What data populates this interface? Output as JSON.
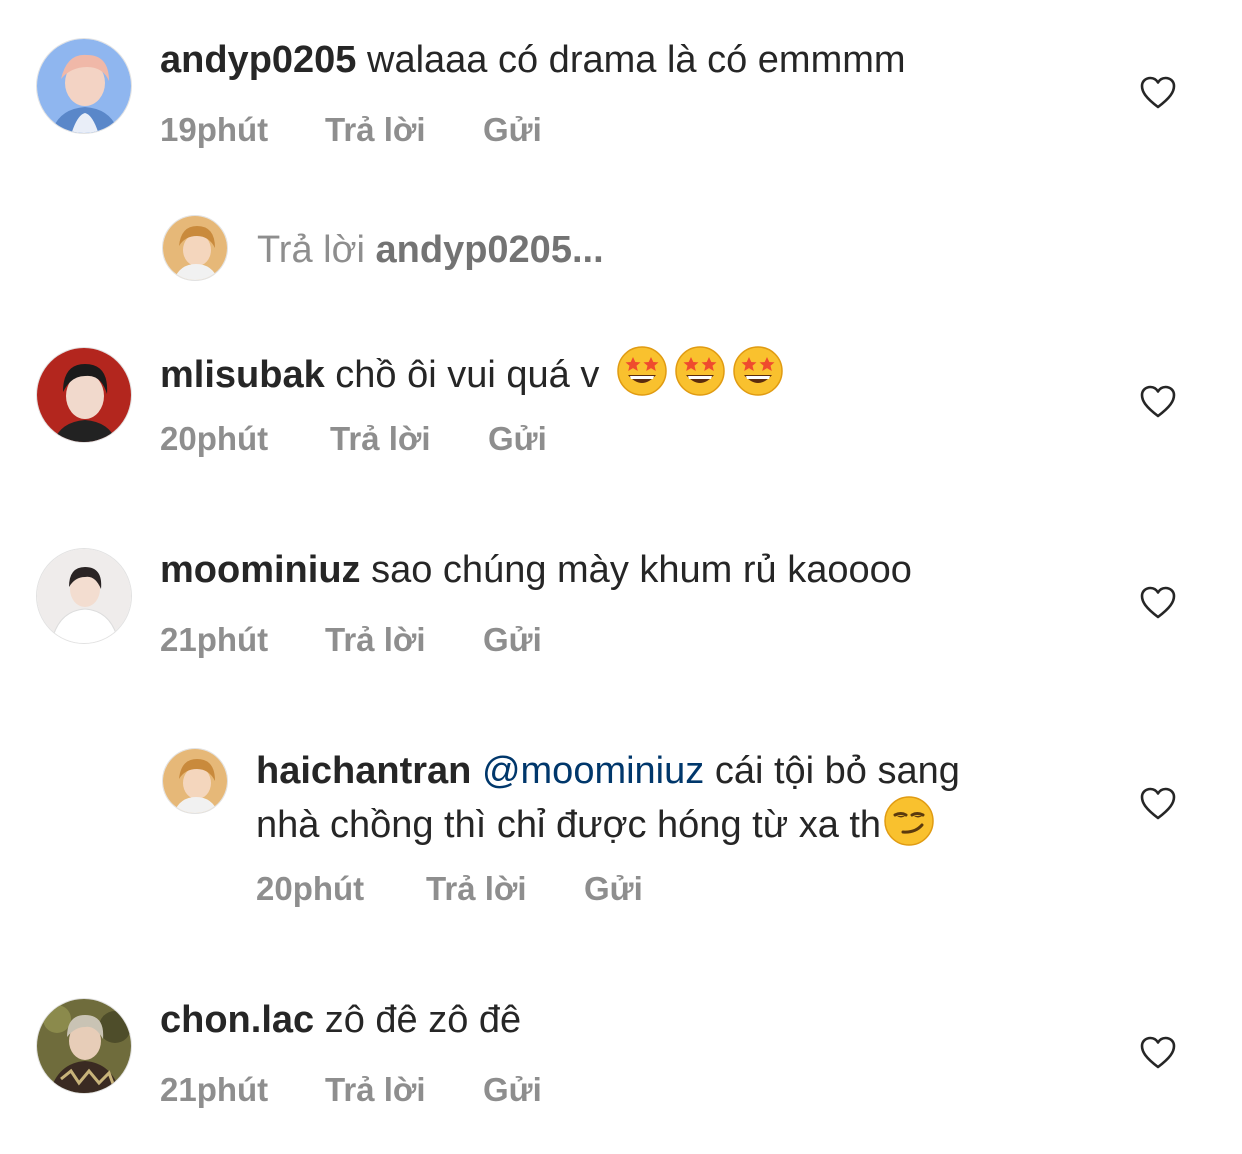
{
  "comments": [
    {
      "username": "andyp0205",
      "text": "walaaa có drama là có emmmm",
      "time": "19phút",
      "reply_label": "Trả lời",
      "send_label": "Gửi",
      "avatar_color": "#7fa9e8",
      "icon": "heart-outline-icon"
    },
    {
      "username": "mlisubak",
      "text": "chồ ôi vui quá v",
      "emoji": [
        "star-struck-emoji",
        "star-struck-emoji",
        "star-struck-emoji"
      ],
      "time": "20phút",
      "reply_label": "Trả lời",
      "send_label": "Gửi",
      "avatar_color": "#b52a22",
      "icon": "heart-outline-icon"
    },
    {
      "username": "moominiuz",
      "text": "sao chúng mày khum rủ kaoooo",
      "time": "21phút",
      "reply_label": "Trả lời",
      "send_label": "Gửi",
      "avatar_color": "#ece9e6",
      "icon": "heart-outline-icon"
    },
    {
      "username": "chon.lac",
      "text": "zô đê zô đê",
      "time": "21phút",
      "reply_label": "Trả lời",
      "send_label": "Gửi",
      "avatar_color": "#5b5a3a",
      "icon": "heart-outline-icon"
    }
  ],
  "reply_prompt": {
    "prefix": "Trả lời",
    "target": "andyp0205..."
  },
  "reply": {
    "username": "haichantran",
    "mention": "@moominiuz",
    "text_line1": "cái tội bỏ sang",
    "text_line2": "nhà chồng thì chỉ được hóng từ xa th",
    "emoji": "smirk-emoji",
    "time": "20phút",
    "reply_label": "Trả lời",
    "send_label": "Gửi",
    "avatar_color": "#d9a25a"
  },
  "colors": {
    "text": "#262626",
    "meta": "#8e8e8e",
    "mention": "#00376b"
  }
}
